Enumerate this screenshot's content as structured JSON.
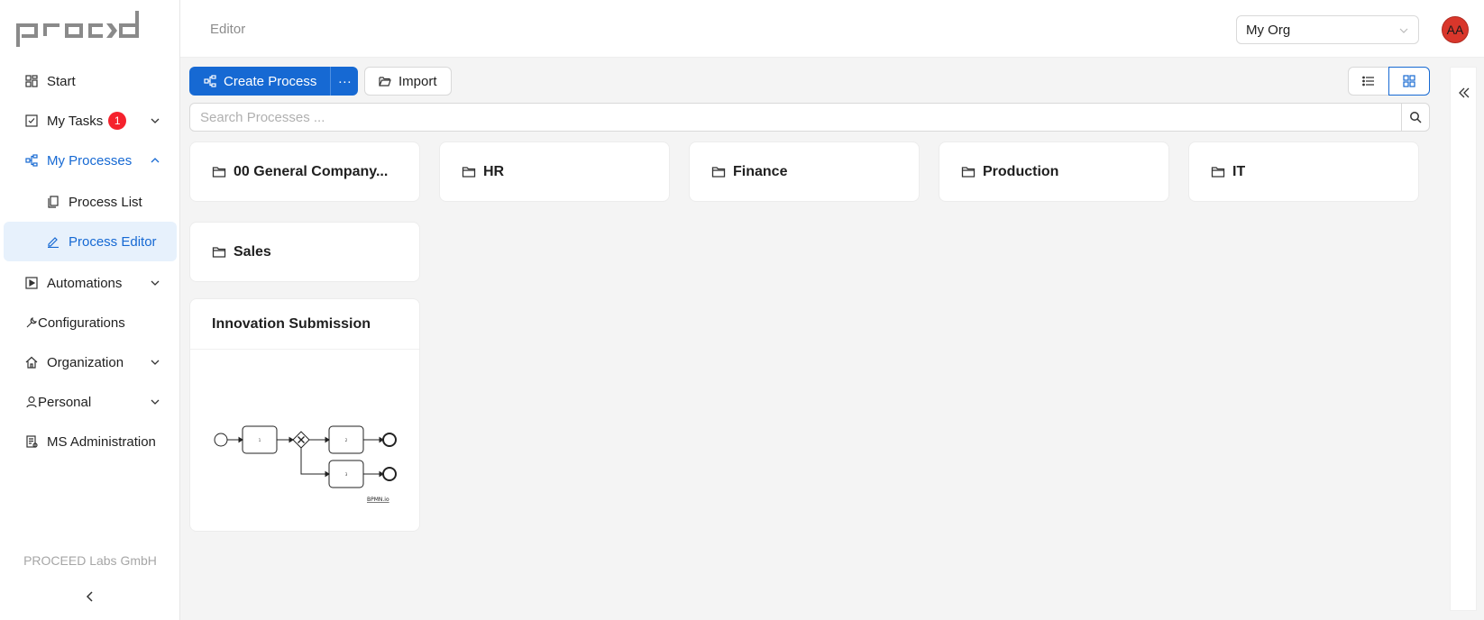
{
  "app": {
    "logo_text": "PROCEED"
  },
  "header": {
    "title": "Editor",
    "org_select_value": "My Org",
    "avatar_initials": "AA"
  },
  "sidebar": {
    "items": [
      {
        "label": "Start",
        "icon": "dashboard-icon"
      },
      {
        "label": "My Tasks",
        "icon": "check-square-icon",
        "badge": "1"
      },
      {
        "label": "My Processes",
        "icon": "partition-icon"
      },
      {
        "label": "Process List",
        "icon": "copy-icon"
      },
      {
        "label": "Process Editor",
        "icon": "edit-icon"
      },
      {
        "label": "Automations",
        "icon": "play-square-icon"
      },
      {
        "label": "Configurations",
        "icon": "tool-icon"
      },
      {
        "label": "Organization",
        "icon": "home-icon"
      },
      {
        "label": "Personal",
        "icon": "user-icon"
      },
      {
        "label": "MS Administration",
        "icon": "audit-icon"
      }
    ],
    "footer_company": "PROCEED Labs GmbH"
  },
  "toolbar": {
    "create_label": "Create Process",
    "more_label": "···",
    "import_label": "Import",
    "view_modes": [
      "list",
      "grid"
    ],
    "active_view": "grid"
  },
  "search": {
    "placeholder": "Search Processes ..."
  },
  "folders": [
    {
      "name": "00 General Company..."
    },
    {
      "name": "HR"
    },
    {
      "name": "Finance"
    },
    {
      "name": "Production"
    },
    {
      "name": "IT"
    },
    {
      "name": "Sales"
    }
  ],
  "processes": [
    {
      "name": "Innovation Submission",
      "diagram_tasks": [
        "1",
        "2",
        "3"
      ],
      "diagram_label": "BPMN.io"
    }
  ],
  "colors": {
    "primary": "#1669d3",
    "badge": "#f5222d",
    "avatar": "#d9362b"
  }
}
